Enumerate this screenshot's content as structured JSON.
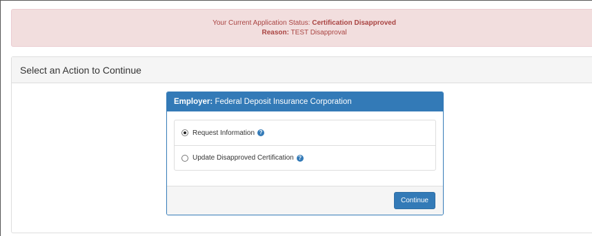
{
  "alert": {
    "status_prefix": "Your Current Application Status:",
    "status_value": "Certification Disapproved",
    "reason_label": "Reason:",
    "reason_value": "TEST Disapproval"
  },
  "panel": {
    "title": "Select an Action to Continue"
  },
  "card": {
    "employer_label": "Employer:",
    "employer_name": "Federal Deposit Insurance Corporation",
    "options": [
      {
        "label": "Request Information",
        "selected": true,
        "icon": "question-circle-icon"
      },
      {
        "label": "Update Disapproved Certification",
        "selected": false,
        "icon": "question-circle-icon"
      }
    ],
    "continue_label": "Continue"
  },
  "colors": {
    "alert_bg": "#f2dede",
    "alert_text": "#a94442",
    "primary": "#337ab7"
  }
}
